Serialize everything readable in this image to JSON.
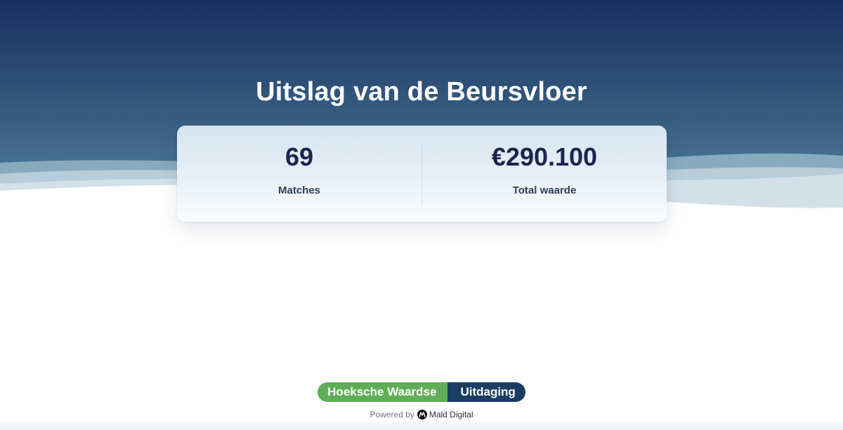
{
  "page": {
    "title": "Uitslag van de Beursvloer"
  },
  "stats": [
    {
      "value": "69",
      "label": "Matches"
    },
    {
      "value": "€290.100",
      "label": "Total waarde"
    }
  ],
  "footer": {
    "brand_left": "Hoeksche Waardse",
    "brand_right": "Uitdaging",
    "powered_by": "Powered by",
    "company": "Mald Digital"
  },
  "colors": {
    "hero_top": "#183060",
    "hero_bottom": "#4e7f9c",
    "stat_value": "#1c2450",
    "brand_green": "#5fae57",
    "brand_blue": "#1c3d63"
  },
  "icons": {
    "company_logo": "mald-digital-logo-icon"
  }
}
